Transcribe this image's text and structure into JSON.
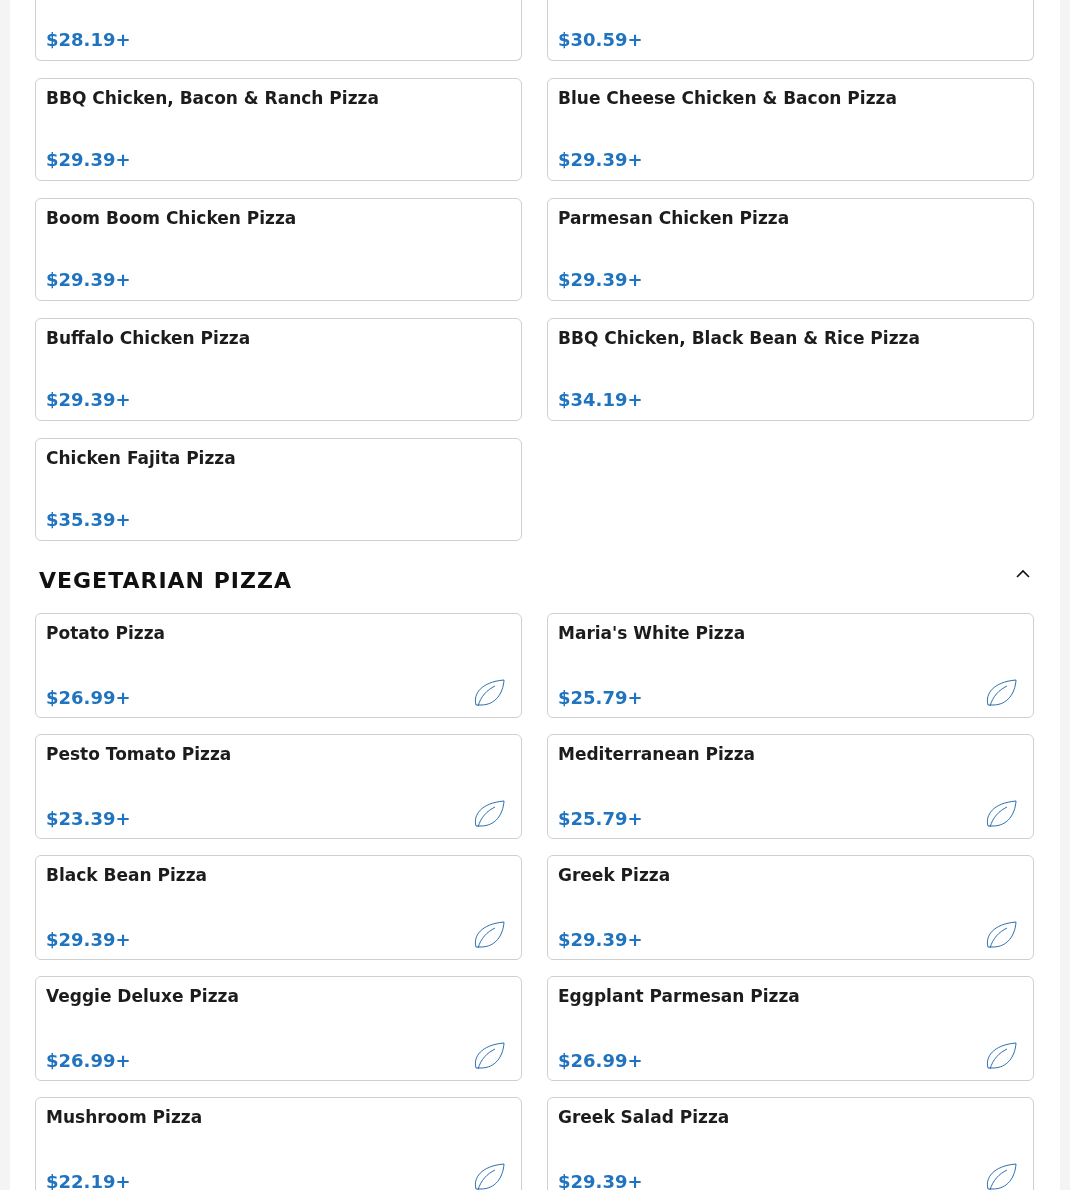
{
  "chicken_section": {
    "items": [
      {
        "price": "$28.19+",
        "vegetarian": false
      },
      {
        "price": "$30.59+",
        "vegetarian": false
      },
      {
        "name": "BBQ Chicken, Bacon & Ranch Pizza",
        "price": "$29.39+",
        "vegetarian": false
      },
      {
        "name": "Blue Cheese Chicken & Bacon Pizza",
        "price": "$29.39+",
        "vegetarian": false
      },
      {
        "name": "Boom Boom Chicken Pizza",
        "price": "$29.39+",
        "vegetarian": false
      },
      {
        "name": "Parmesan Chicken Pizza",
        "price": "$29.39+",
        "vegetarian": false
      },
      {
        "name": "Buffalo Chicken Pizza",
        "price": "$29.39+",
        "vegetarian": false
      },
      {
        "name": "BBQ Chicken, Black Bean & Rice Pizza",
        "price": "$34.19+",
        "vegetarian": false
      },
      {
        "name": "Chicken Fajita Pizza",
        "price": "$35.39+",
        "vegetarian": false
      }
    ]
  },
  "vegetarian_section": {
    "title": "VEGETARIAN PIZZA",
    "expanded": true,
    "items": [
      {
        "name": "Potato Pizza",
        "price": "$26.99+",
        "vegetarian": true
      },
      {
        "name": "Maria's White Pizza",
        "price": "$25.79+",
        "vegetarian": true
      },
      {
        "name": "Pesto Tomato Pizza",
        "price": "$23.39+",
        "vegetarian": true
      },
      {
        "name": "Mediterranean Pizza",
        "price": "$25.79+",
        "vegetarian": true
      },
      {
        "name": "Black Bean Pizza",
        "price": "$29.39+",
        "vegetarian": true
      },
      {
        "name": "Greek Pizza",
        "price": "$29.39+",
        "vegetarian": true
      },
      {
        "name": "Veggie Deluxe Pizza",
        "price": "$26.99+",
        "vegetarian": true
      },
      {
        "name": "Eggplant Parmesan Pizza",
        "price": "$26.99+",
        "vegetarian": true
      },
      {
        "name": "Mushroom Pizza",
        "price": "$22.19+",
        "vegetarian": true
      },
      {
        "name": "Greek Salad Pizza",
        "price": "$29.39+",
        "vegetarian": true
      }
    ]
  }
}
